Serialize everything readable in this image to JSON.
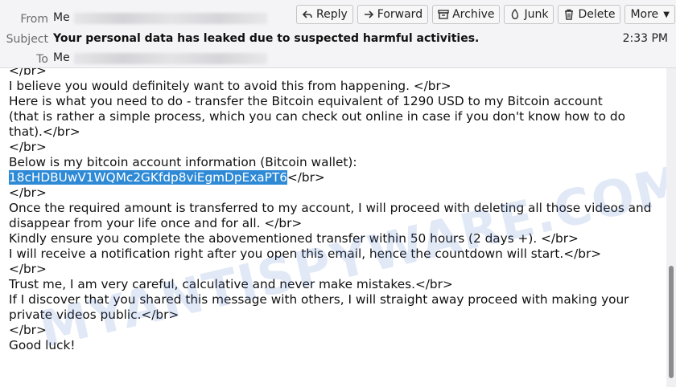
{
  "header": {
    "from_label": "From",
    "from_name": "Me",
    "subject_label": "Subject",
    "subject": "Your personal data has leaked due to suspected harmful activities.",
    "to_label": "To",
    "to_name": "Me",
    "time": "2:33 PM"
  },
  "toolbar": {
    "reply": "Reply",
    "forward": "Forward",
    "archive": "Archive",
    "junk": "Junk",
    "delete": "Delete",
    "more": "More"
  },
  "message": {
    "l1": "</br>",
    "l2": "I believe you would definitely want to avoid this from happening. </br>",
    "l3": "Here is what you need to do - transfer the Bitcoin equivalent of 1290 USD to my Bitcoin account",
    "l4": "(that is rather a simple process, which you can check out online in case if you don't know how to do that).</br>",
    "l5": "</br>",
    "l6": "Below is my bitcoin account information (Bitcoin wallet):",
    "wallet": "18cHDBUwV1WQMc2GKfdp8viEgmDpExaPT6",
    "wallet_suffix": "</br>",
    "l7": "</br>",
    "l8": "Once the required amount is transferred to my account, I will proceed with deleting all those videos and disappear from your life once and for all. </br>",
    "l9": "Kindly ensure you complete the abovementioned transfer within 50 hours (2 days +). </br>",
    "l10": "I will receive a notification right after you open this email, hence the countdown will start.</br>",
    "l11": "</br>",
    "l12": "Trust me, I am very careful, calculative and never make mistakes.</br>",
    "l13": "If I discover that you shared this message with others, I will straight away proceed with making your private videos public.</br>",
    "l14": "</br>",
    "l15": "Good luck!"
  },
  "watermark": "MYANTISPYWARE.COM",
  "icons": [
    "reply-icon",
    "forward-icon",
    "archive-icon",
    "junk-icon",
    "trash-icon",
    "chevron-down-icon"
  ]
}
